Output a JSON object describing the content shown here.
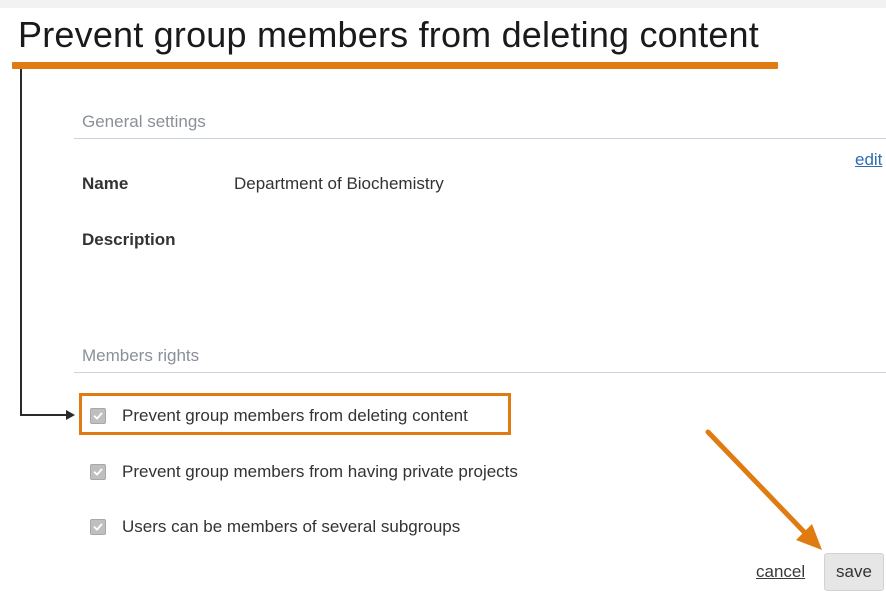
{
  "headline": "Prevent group members from deleting content",
  "general_settings": {
    "title": "General settings",
    "edit_label": "edit",
    "name_label": "Name",
    "name_value": "Department of Biochemistry",
    "description_label": "Description",
    "description_value": ""
  },
  "members_rights": {
    "title": "Members rights",
    "options": [
      {
        "label": "Prevent group members from deleting content",
        "checked": true
      },
      {
        "label": "Prevent group members from having private projects",
        "checked": true
      },
      {
        "label": "Users can be members of several subgroups",
        "checked": true
      }
    ]
  },
  "actions": {
    "cancel_label": "cancel",
    "save_label": "save"
  },
  "colors": {
    "highlight": "#e07b12",
    "link": "#2e6db4",
    "section_title": "#8a9098",
    "checkbox": "#bfbfbf"
  }
}
